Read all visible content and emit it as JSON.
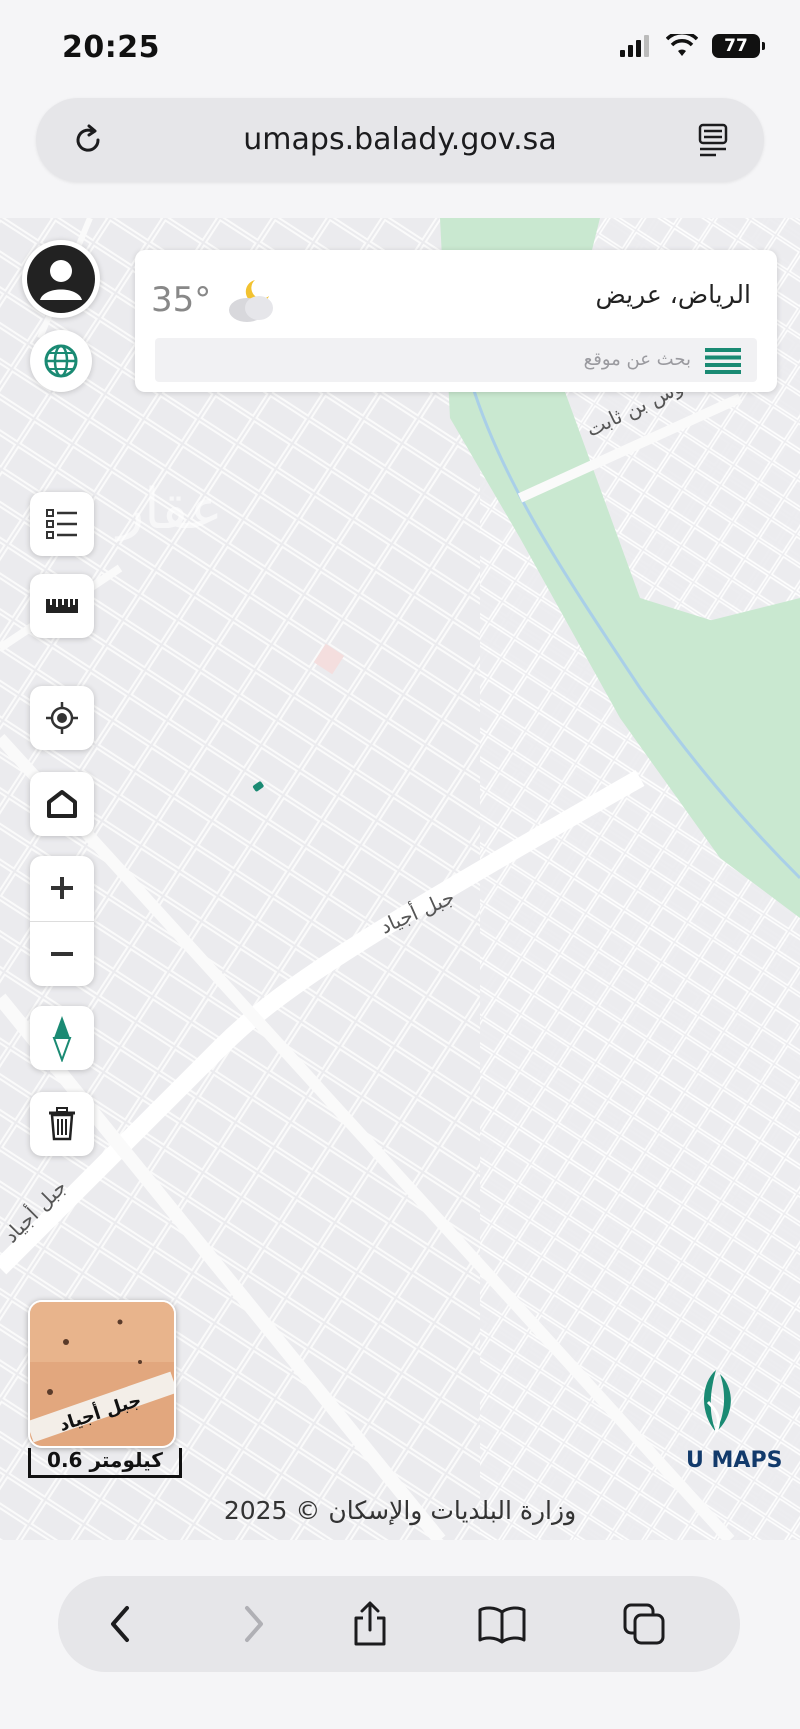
{
  "status": {
    "time": "20:25",
    "battery": "77"
  },
  "browser": {
    "url": "umaps.balady.gov.sa"
  },
  "weather": {
    "city": "الرياض، عريض",
    "temperature": "35°"
  },
  "search": {
    "placeholder": "بحث عن موقع"
  },
  "map_labels": {
    "road_top": "أوس بن ثابت",
    "road_center": "جبل أجياد",
    "road_left": "جبل أجياد",
    "watermark": "عقار"
  },
  "minimap": {
    "label": "جبل أجياد"
  },
  "scale": {
    "label": "0.6 كيلومتر"
  },
  "brand": {
    "name": "U MAPS"
  },
  "footer": {
    "copyright": "وزارة البلديات والإسكان © 2025"
  },
  "colors": {
    "accent": "#1a8a73",
    "park": "#bfe3c8",
    "road": "#ffffff",
    "brand": "#123a6b"
  },
  "icons": [
    "reload-icon",
    "reader-icon",
    "user-icon",
    "globe-icon",
    "legend-icon",
    "ruler-icon",
    "locate-icon",
    "home-icon",
    "zoom-in-icon",
    "zoom-out-icon",
    "compass-icon",
    "trash-icon",
    "back-icon",
    "forward-icon",
    "share-icon",
    "bookmarks-icon",
    "tabs-icon"
  ]
}
